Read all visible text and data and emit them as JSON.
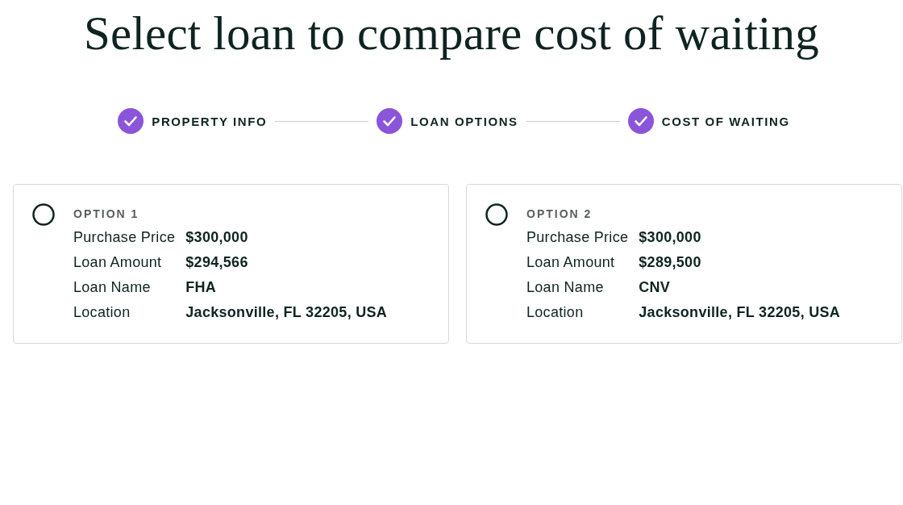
{
  "title": "Select loan to compare cost of waiting",
  "steps": [
    {
      "label": "PROPERTY INFO",
      "completed": true
    },
    {
      "label": "LOAN OPTIONS",
      "completed": true
    },
    {
      "label": "COST OF WAITING",
      "completed": true
    }
  ],
  "options": [
    {
      "heading": "OPTION 1",
      "selected": false,
      "rows": [
        {
          "label": "Purchase Price",
          "value": "$300,000"
        },
        {
          "label": "Loan Amount",
          "value": "$294,566"
        },
        {
          "label": "Loan Name",
          "value": "FHA"
        },
        {
          "label": "Location",
          "value": "Jacksonville, FL 32205, USA"
        }
      ]
    },
    {
      "heading": "OPTION 2",
      "selected": false,
      "rows": [
        {
          "label": "Purchase Price",
          "value": "$300,000"
        },
        {
          "label": "Loan Amount",
          "value": "$289,500"
        },
        {
          "label": "Loan Name",
          "value": "CNV"
        },
        {
          "label": "Location",
          "value": "Jacksonville, FL 32205, USA"
        }
      ]
    }
  ]
}
